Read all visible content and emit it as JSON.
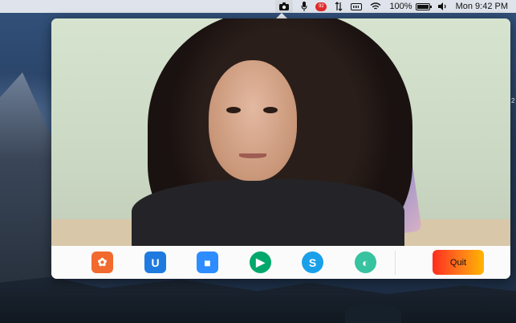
{
  "menubar": {
    "battery_percent": "100%",
    "clock": "Mon 9:42 PM",
    "recording_badge": "92",
    "battery_level": 1.0
  },
  "toolbar": {
    "apps": [
      {
        "name": "Webex Meet",
        "icon": "webex-flower-icon",
        "color": "#f26a2e",
        "glyph": "✿"
      },
      {
        "name": "Microsoft Teams",
        "icon": "teams-u-icon",
        "color": "#1f7ae0",
        "glyph": "U"
      },
      {
        "name": "Zoom",
        "icon": "zoom-camera-icon",
        "color": "#2d8cff",
        "glyph": "■"
      },
      {
        "name": "Google Meet",
        "icon": "google-meet-icon",
        "color": "#00a86b",
        "glyph": "▶"
      },
      {
        "name": "Skype",
        "icon": "skype-icon",
        "color": "#1aa0e8",
        "glyph": "S"
      },
      {
        "name": "Webex",
        "icon": "webex-ring-icon",
        "color": "#37c2a0",
        "glyph": "◐"
      }
    ],
    "quit_label": "Quit"
  },
  "desktop": {
    "edge_label": "2"
  }
}
